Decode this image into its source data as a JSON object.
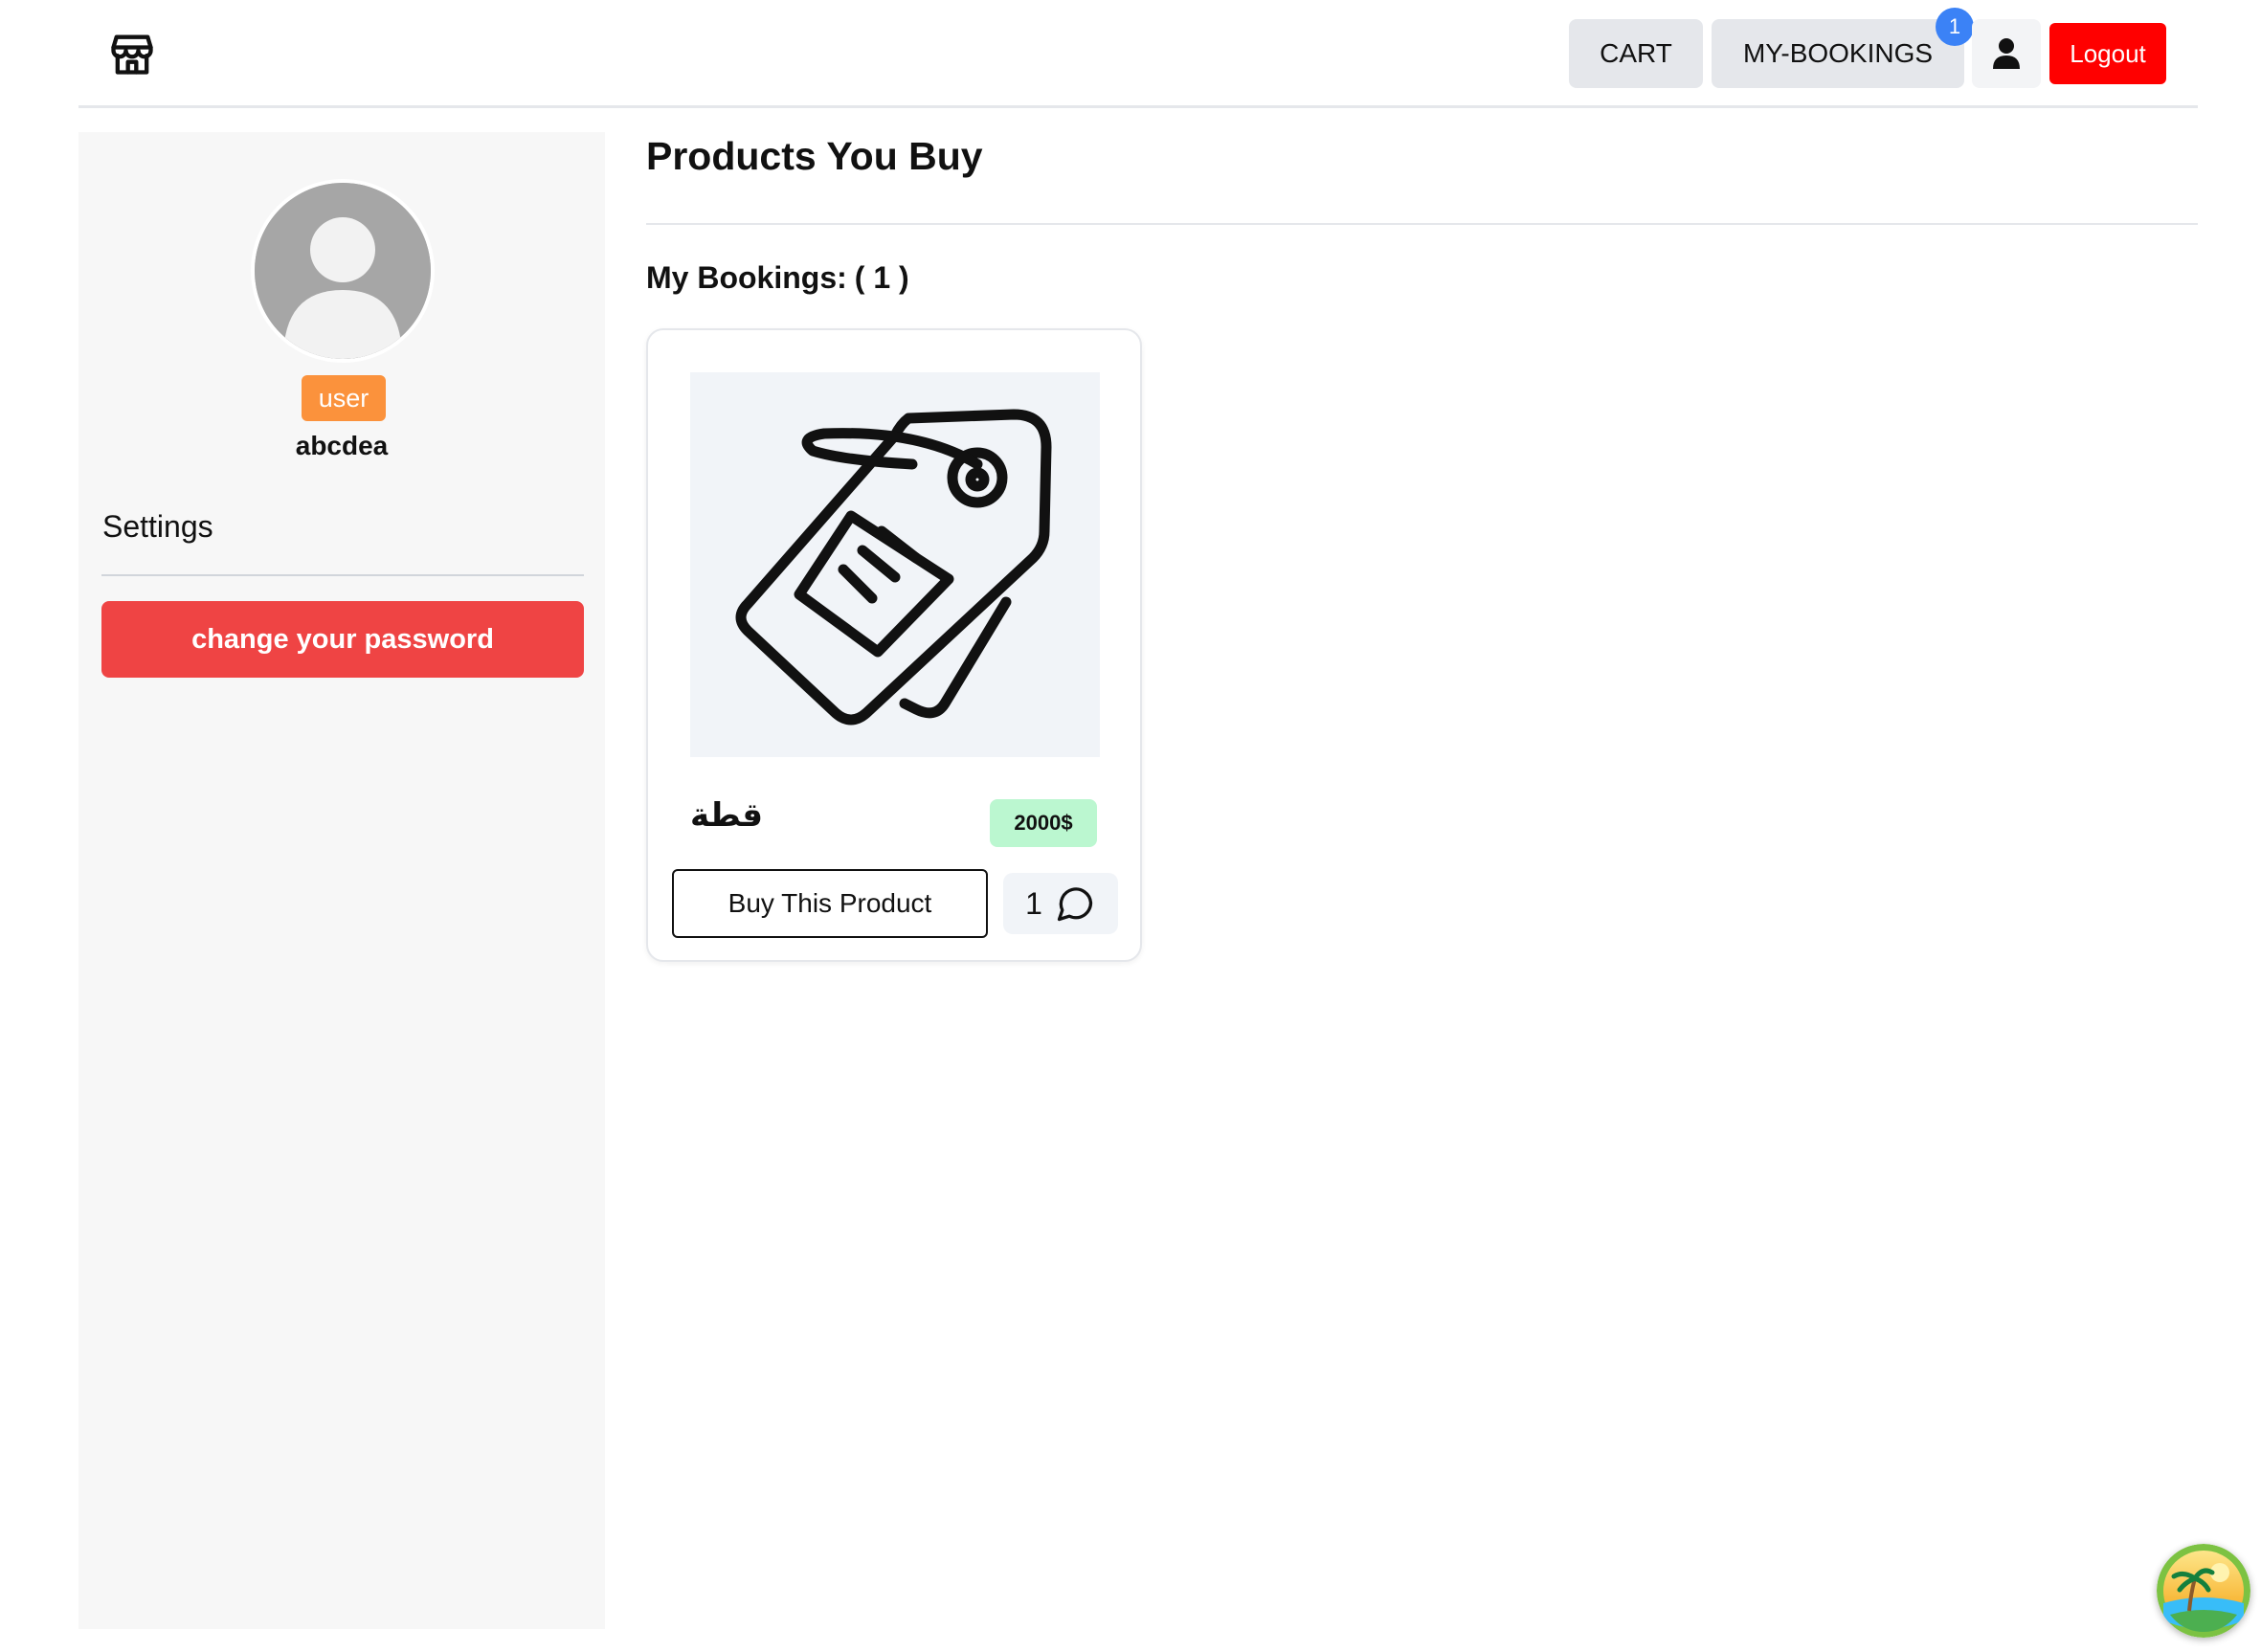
{
  "header": {
    "nav": {
      "cart_label": "CART",
      "bookings_label": "MY-BOOKINGS",
      "bookings_badge": "1",
      "logout_label": "Logout"
    }
  },
  "sidebar": {
    "role": "user",
    "username": "abcdea",
    "settings_title": "Settings",
    "change_password_label": "change your password"
  },
  "main": {
    "page_title": "Products You Buy",
    "bookings_label": "My Bookings:",
    "bookings_count": "( 1 )",
    "products": [
      {
        "name": "قطة",
        "price": "2000$",
        "buy_label": "Buy This Product",
        "comment_count": "1",
        "image_icon": "price-tag-icon"
      }
    ]
  },
  "colors": {
    "danger": "#ef4444",
    "logout": "#ff0000",
    "badge_blue": "#3b82f6",
    "role_orange": "#fb923c",
    "price_green": "#bbf7d0"
  }
}
